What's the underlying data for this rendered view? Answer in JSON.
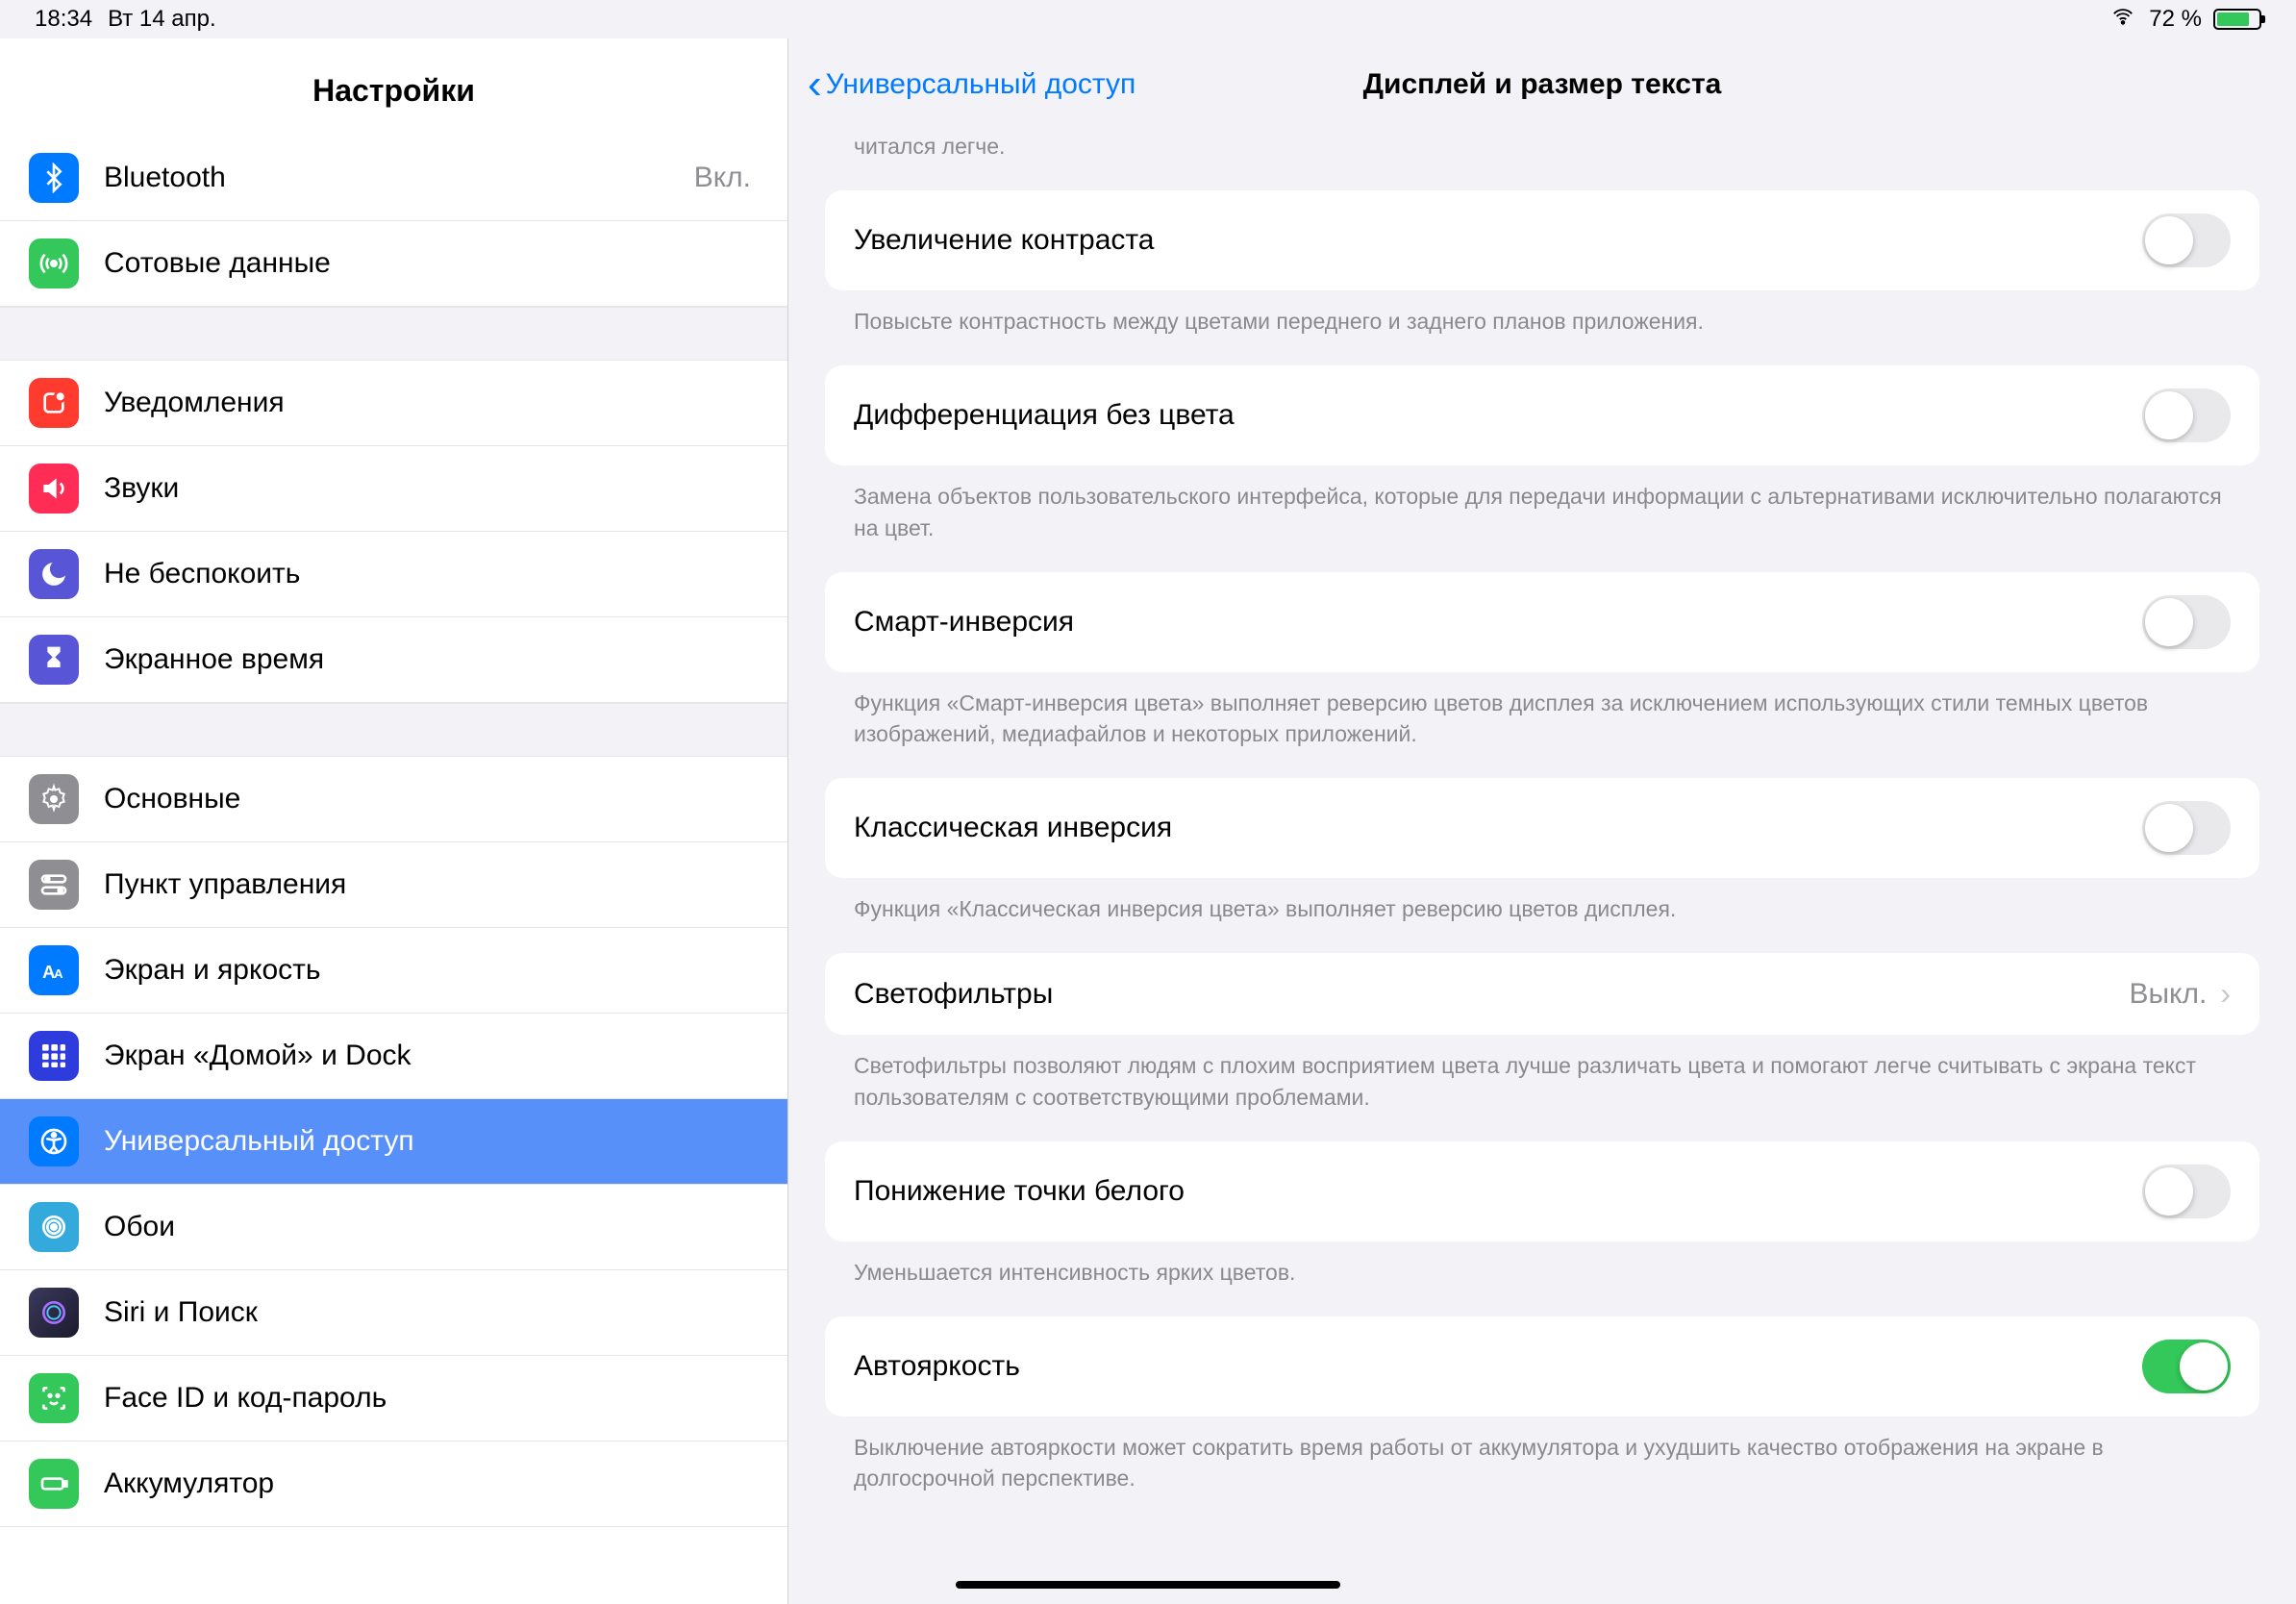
{
  "status": {
    "time": "18:34",
    "date": "Вт 14 апр.",
    "battery": "72 %"
  },
  "sidebar": {
    "title": "Настройки",
    "items": [
      {
        "label": "Bluetooth",
        "value": "Вкл.",
        "color": "#007aff",
        "icon": "bluetooth"
      },
      {
        "label": "Сотовые данные",
        "color": "#34c759",
        "icon": "antenna"
      }
    ],
    "group2": [
      {
        "label": "Уведомления",
        "color": "#ff3b30",
        "icon": "notifications"
      },
      {
        "label": "Звуки",
        "color": "#ff2d55",
        "icon": "sounds"
      },
      {
        "label": "Не беспокоить",
        "color": "#5856d6",
        "icon": "moon"
      },
      {
        "label": "Экранное время",
        "color": "#5856d6",
        "icon": "hourglass"
      }
    ],
    "group3": [
      {
        "label": "Основные",
        "color": "#8e8e93",
        "icon": "gear"
      },
      {
        "label": "Пункт управления",
        "color": "#8e8e93",
        "icon": "switches"
      },
      {
        "label": "Экран и яркость",
        "color": "#007aff",
        "icon": "aa"
      },
      {
        "label": "Экран «Домой» и Dock",
        "color": "#2f3cdd",
        "icon": "grid"
      },
      {
        "label": "Универсальный доступ",
        "color": "#007aff",
        "icon": "accessibility",
        "selected": true
      },
      {
        "label": "Обои",
        "color": "#34aadc",
        "icon": "wallpaper"
      },
      {
        "label": "Siri и Поиск",
        "color": "#2b2b3a",
        "icon": "siri"
      },
      {
        "label": "Face ID и код-пароль",
        "color": "#34c759",
        "icon": "faceid"
      },
      {
        "label": "Аккумулятор",
        "color": "#34c759",
        "icon": "battery"
      }
    ]
  },
  "detail": {
    "back_label": "Универсальный доступ",
    "title": "Дисплей и размер текста",
    "top_footer": "читался легче.",
    "rows": {
      "contrast": {
        "label": "Увеличение контраста",
        "footer": "Повысьте контрастность между цветами переднего и заднего планов приложения."
      },
      "diff": {
        "label": "Дифференциация без цвета",
        "footer": "Замена объектов пользовательского интерфейса, которые для передачи информации с альтернативами исключительно полагаются на цвет."
      },
      "smart": {
        "label": "Смарт-инверсия",
        "footer": "Функция «Смарт-инверсия цвета» выполняет реверсию цветов дисплея за исключением использующих стили темных цветов изображений, медиафайлов и некоторых приложений."
      },
      "classic": {
        "label": "Классическая инверсия",
        "footer": "Функция «Классическая инверсия цвета» выполняет реверсию цветов дисплея."
      },
      "filters": {
        "label": "Светофильтры",
        "value": "Выкл.",
        "footer": "Светофильтры позволяют людям с плохим восприятием цвета лучше различать цвета и помогают легче считывать с экрана текст пользователям с соответствующими проблемами."
      },
      "whitepoint": {
        "label": "Понижение точки белого",
        "footer": "Уменьшается интенсивность ярких цветов."
      },
      "autobright": {
        "label": "Автояркость",
        "on": true,
        "footer": "Выключение автояркости может сократить время работы от аккумулятора и ухудшить качество отображения на экране в долгосрочной перспективе."
      }
    }
  }
}
